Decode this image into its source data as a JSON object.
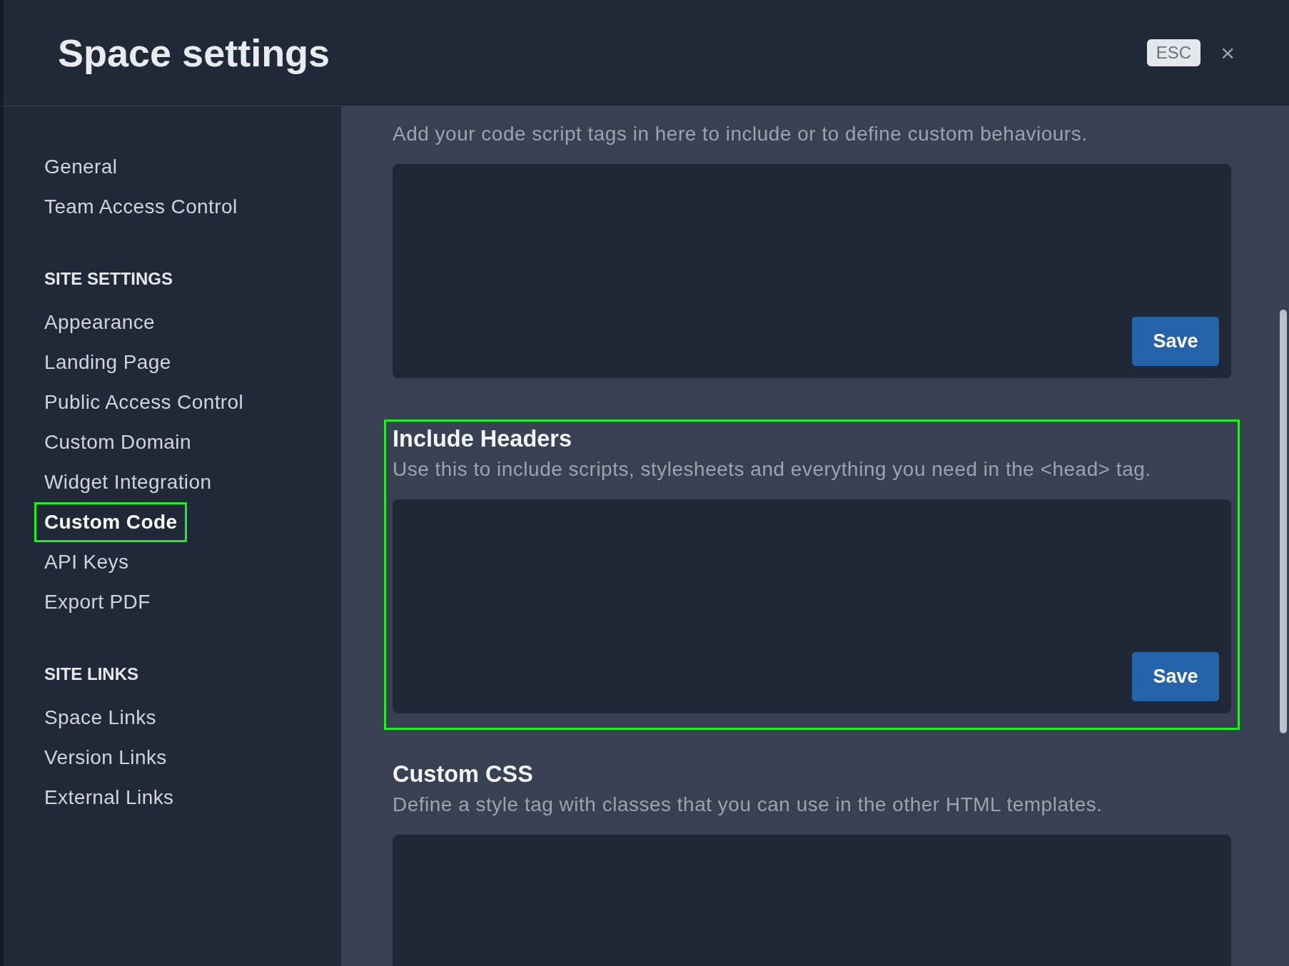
{
  "window": {
    "title": "Space settings",
    "shortcut": "ESC",
    "close": "×"
  },
  "sidebar": {
    "groups": [
      {
        "items": [
          {
            "label": "General",
            "selected": false,
            "highlighted": false
          },
          {
            "label": "Team Access Control",
            "selected": false,
            "highlighted": false
          }
        ]
      },
      {
        "heading": "SITE SETTINGS",
        "items": [
          {
            "label": "Appearance",
            "selected": false,
            "highlighted": false
          },
          {
            "label": "Landing Page",
            "selected": false,
            "highlighted": false
          },
          {
            "label": "Public Access Control",
            "selected": false,
            "highlighted": false
          },
          {
            "label": "Custom Domain",
            "selected": false,
            "highlighted": false
          },
          {
            "label": "Widget Integration",
            "selected": false,
            "highlighted": false
          },
          {
            "label": "Custom Code",
            "selected": true,
            "highlighted": true
          },
          {
            "label": "API Keys",
            "selected": false,
            "highlighted": false
          },
          {
            "label": "Export PDF",
            "selected": false,
            "highlighted": false
          }
        ]
      },
      {
        "heading": "SITE LINKS",
        "items": [
          {
            "label": "Space Links",
            "selected": false,
            "highlighted": false
          },
          {
            "label": "Version Links",
            "selected": false,
            "highlighted": false
          },
          {
            "label": "External Links",
            "selected": false,
            "highlighted": false
          }
        ]
      }
    ]
  },
  "sections": [
    {
      "description": "Add your code script tags in here to include or to define custom behaviours.",
      "highlighted": false,
      "button": "Save"
    },
    {
      "title": "Include Headers",
      "description": "Use this to include scripts, stylesheets and everything you need in the <head> tag.",
      "highlighted": true,
      "button": "Save"
    },
    {
      "title": "Custom CSS",
      "description": "Define a style tag with classes that you can use in the other HTML templates.",
      "highlighted": false
    }
  ]
}
